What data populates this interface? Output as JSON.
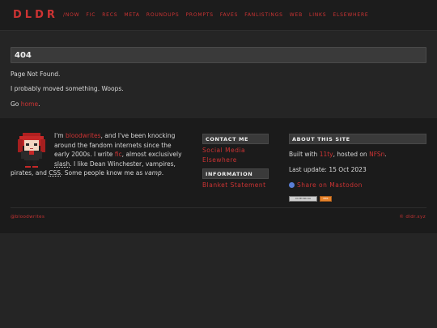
{
  "header": {
    "logo": "DLDR",
    "nav": [
      "/NOW",
      "FIC",
      "RECS",
      "META",
      "ROUNDUPS",
      "PROMPTS",
      "FAVES",
      "FANLISTINGS",
      "WEB",
      "LINKS",
      "ELSEWHERE"
    ]
  },
  "main": {
    "title": "404",
    "line1": "Page Not Found.",
    "line2": "I probably moved something. Woops.",
    "go_prefix": "Go ",
    "go_link": "home",
    "go_suffix": "."
  },
  "bio": {
    "t1": "I'm ",
    "name_link": "bloodwrites",
    "t2": ", and I've been knocking around the fandom internets since the early 2000s. I write ",
    "fic_link": "fic",
    "t3": ", almost exclusively ",
    "slash": "slash",
    "t4": ". I like Dean Winchester, vampires, pirates, and ",
    "css": "CSS",
    "t5": ". Some people know me as ",
    "vamp": "vamp",
    "t6": "."
  },
  "contact": {
    "heading": "CONTACT ME",
    "links": [
      "Social Media",
      "Elsewhere"
    ]
  },
  "information": {
    "heading": "INFORMATION",
    "links": [
      "Blanket Statement"
    ]
  },
  "about": {
    "heading": "ABOUT THIS SITE",
    "built_prefix": "Built with ",
    "built_link1": "11ty",
    "built_mid": ", hosted on ",
    "built_link2": "NFSn",
    "built_suffix": ".",
    "last_update": "Last update: 15 Oct 2023",
    "mastodon": "Share on Mastodon",
    "badge_cc": "CC BY-NC-SA",
    "badge_rss": "RSS"
  },
  "footer": {
    "left": "@bloodwrites",
    "right": "© dldr.xyz"
  },
  "colors": {
    "accent": "#cc3333",
    "background": "#252525",
    "footer_bg": "#1b1b1b"
  }
}
